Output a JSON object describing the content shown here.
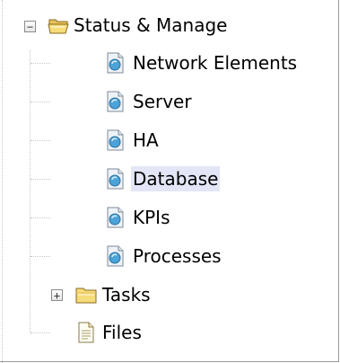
{
  "tree": {
    "root": {
      "label": "Status & Manage",
      "expander": "−",
      "icon": "open-folder-icon",
      "children": [
        {
          "label": "Network Elements",
          "icon": "page-icon"
        },
        {
          "label": "Server",
          "icon": "page-icon"
        },
        {
          "label": "HA",
          "icon": "page-icon"
        },
        {
          "label": "Database",
          "icon": "page-icon",
          "selected": true
        },
        {
          "label": "KPIs",
          "icon": "page-icon"
        },
        {
          "label": "Processes",
          "icon": "page-icon"
        },
        {
          "label": "Tasks",
          "icon": "closed-folder-icon",
          "expander": "+"
        },
        {
          "label": "Files",
          "icon": "file-icon"
        }
      ]
    },
    "colors": {
      "folder": "#f6dc7a",
      "selection": "#e3e6f6",
      "guide": "#c8c8c8"
    }
  }
}
